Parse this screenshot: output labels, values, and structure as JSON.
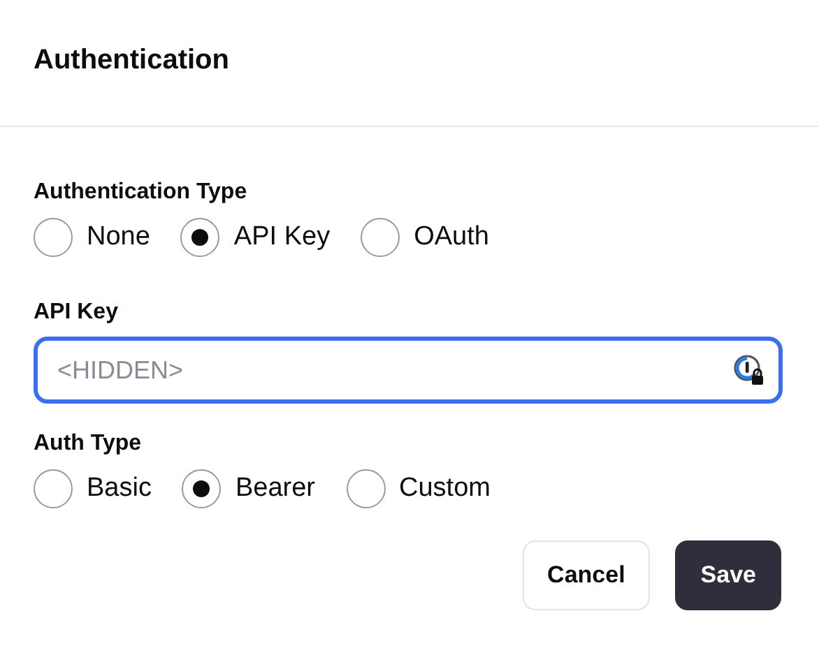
{
  "dialog": {
    "title": "Authentication"
  },
  "auth_type": {
    "label": "Authentication Type",
    "options": [
      {
        "label": "None",
        "selected": false
      },
      {
        "label": "API Key",
        "selected": true
      },
      {
        "label": "OAuth",
        "selected": false
      }
    ]
  },
  "api_key": {
    "label": "API Key",
    "placeholder": "<HIDDEN>"
  },
  "header_type": {
    "label": "Auth Type",
    "options": [
      {
        "label": "Basic",
        "selected": false
      },
      {
        "label": "Bearer",
        "selected": true
      },
      {
        "label": "Custom",
        "selected": false
      }
    ]
  },
  "buttons": [
    {
      "label": "Cancel",
      "kind": "secondary"
    },
    {
      "label": "Save",
      "kind": "primary"
    }
  ]
}
